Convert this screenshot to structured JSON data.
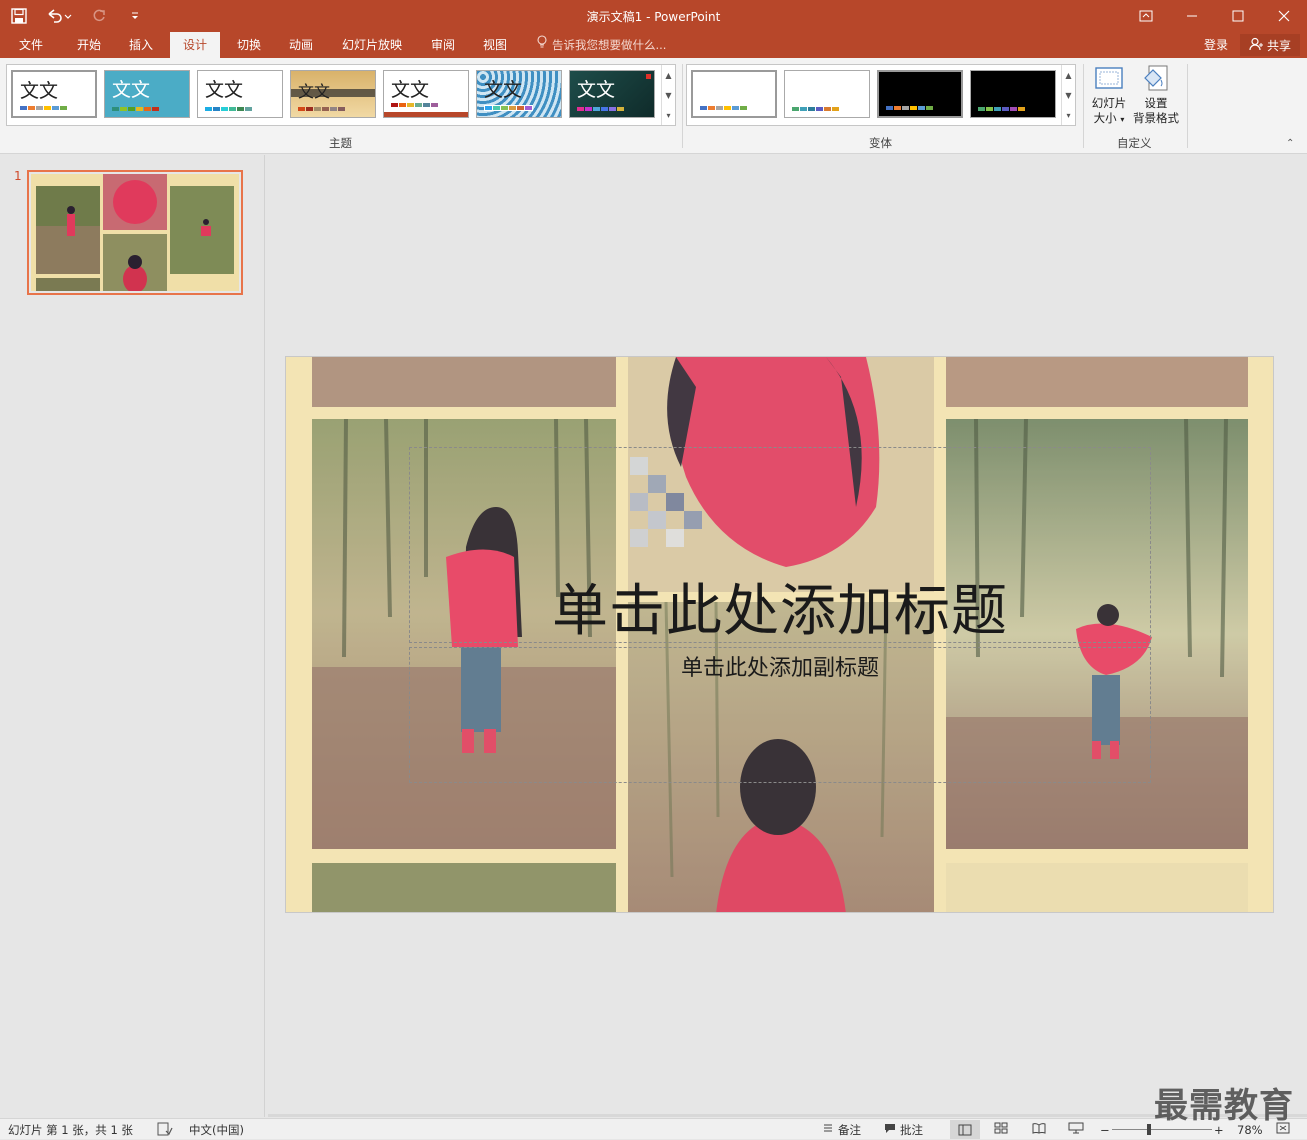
{
  "window": {
    "title": "演示文稿1 - PowerPoint"
  },
  "tabs": [
    {
      "label": "文件"
    },
    {
      "label": "开始"
    },
    {
      "label": "插入"
    },
    {
      "label": "设计"
    },
    {
      "label": "切换"
    },
    {
      "label": "动画"
    },
    {
      "label": "幻灯片放映"
    },
    {
      "label": "审阅"
    },
    {
      "label": "视图"
    }
  ],
  "tell_me": {
    "placeholder": "告诉我您想要做什么..."
  },
  "account": {
    "login_label": "登录",
    "share_label": "共享"
  },
  "ribbon": {
    "themes_label": "主题",
    "variants_label": "变体",
    "customize_label": "自定义",
    "theme_sample_text": "文文",
    "slide_size": {
      "line1": "幻灯片",
      "line2": "大小"
    },
    "format_bg": {
      "line1": "设置",
      "line2": "背景格式"
    }
  },
  "slide_panel": {
    "slide_number": "1"
  },
  "slide": {
    "title_placeholder": "单击此处添加标题",
    "subtitle_placeholder": "单击此处添加副标题"
  },
  "status": {
    "slide_info": "幻灯片 第 1 张，共 1 张",
    "language": "中文(中国)",
    "notes_label": "备注",
    "comments_label": "批注",
    "zoom": "78%"
  },
  "watermark": "最需教育",
  "colors": {
    "accent": "#b7472a",
    "selection": "#e8744a"
  }
}
